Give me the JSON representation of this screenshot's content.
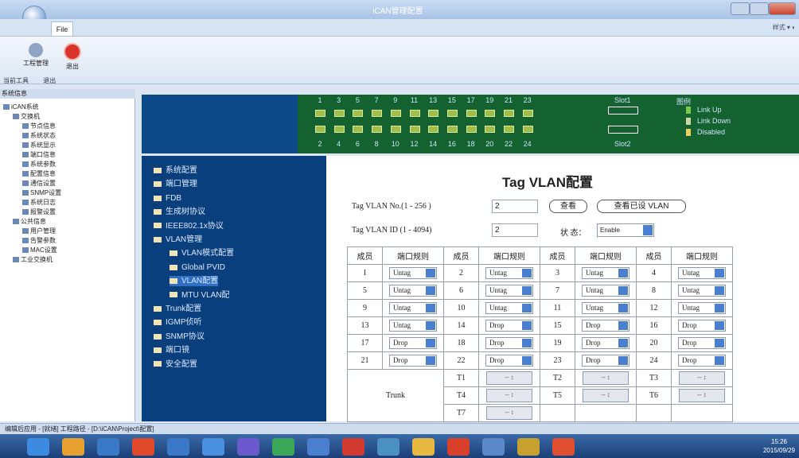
{
  "window": {
    "title": "iCAN管理配置"
  },
  "ribbon": {
    "file_tab": "File",
    "right_label": "样式 ▾ ◐",
    "buttons": [
      {
        "label": "工程管理"
      },
      {
        "label": "退出"
      }
    ],
    "groups": [
      "当前工具",
      "退出"
    ]
  },
  "tree": {
    "header": "系统信息",
    "items": [
      {
        "label": "iCAN系统",
        "level": 0
      },
      {
        "label": "交换机",
        "level": 1
      },
      {
        "label": "节点信息",
        "level": 2
      },
      {
        "label": "系统状态",
        "level": 2
      },
      {
        "label": "系统显示",
        "level": 2
      },
      {
        "label": "端口信息",
        "level": 2
      },
      {
        "label": "系统参数",
        "level": 2
      },
      {
        "label": "配置信息",
        "level": 2
      },
      {
        "label": "通信设置",
        "level": 2
      },
      {
        "label": "SNMP设置",
        "level": 2
      },
      {
        "label": "系统日志",
        "level": 2
      },
      {
        "label": "报警设置",
        "level": 2
      },
      {
        "label": "公共信息",
        "level": 1
      },
      {
        "label": "用户管理",
        "level": 2
      },
      {
        "label": "告警参数",
        "level": 2
      },
      {
        "label": "MAC设置",
        "level": 2
      },
      {
        "label": "工业交换机",
        "level": 1
      }
    ]
  },
  "ports": {
    "top_numbers": [
      "1",
      "3",
      "5",
      "7",
      "9",
      "11",
      "13",
      "15",
      "17",
      "19",
      "21",
      "23"
    ],
    "bottom_numbers": [
      "2",
      "4",
      "6",
      "8",
      "10",
      "12",
      "14",
      "16",
      "18",
      "20",
      "22",
      "24"
    ],
    "slot1": "Slot1",
    "slot2": "Slot2",
    "legend_title": "图例",
    "legend": [
      {
        "label": "Link Up",
        "color": "#7ec850"
      },
      {
        "label": "Link Down",
        "color": "#c8d8a0"
      },
      {
        "label": "Disabled",
        "color": "#e8d060"
      }
    ]
  },
  "menu": {
    "items": [
      {
        "label": "系统配置",
        "indent": 0,
        "selected": false
      },
      {
        "label": "端口管理",
        "indent": 0,
        "selected": false
      },
      {
        "label": "FDB",
        "indent": 0,
        "selected": false
      },
      {
        "label": "生成树协议",
        "indent": 0,
        "selected": false
      },
      {
        "label": "IEEE802.1x协议",
        "indent": 0,
        "selected": false
      },
      {
        "label": "VLAN管理",
        "indent": 0,
        "selected": false
      },
      {
        "label": "VLAN模式配置",
        "indent": 1,
        "selected": false
      },
      {
        "label": "Global PVID",
        "indent": 1,
        "selected": false
      },
      {
        "label": "VLAN配置",
        "indent": 1,
        "selected": true
      },
      {
        "label": "MTU VLAN配",
        "indent": 1,
        "selected": false
      },
      {
        "label": "Trunk配置",
        "indent": 0,
        "selected": false
      },
      {
        "label": "IGMP侦听",
        "indent": 0,
        "selected": false
      },
      {
        "label": "SNMP协议",
        "indent": 0,
        "selected": false
      },
      {
        "label": "端口镜",
        "indent": 0,
        "selected": false
      },
      {
        "label": "安全配置",
        "indent": 0,
        "selected": false
      }
    ]
  },
  "form": {
    "title": "Tag VLAN配置",
    "vlan_no_label": "Tag VLAN No.(1 - 256 )",
    "vlan_no_value": "2",
    "view_button": "查看",
    "view_all_button": "查看已设 VLAN",
    "vlan_id_label": "Tag VLAN ID (1 - 4094)",
    "vlan_id_value": "2",
    "status_label": "状 态：",
    "status_value": "Enable"
  },
  "table": {
    "headers": [
      "成员",
      "端口规则",
      "成员",
      "端口规则",
      "成员",
      "端口规则",
      "成员",
      "端口规则"
    ],
    "rows": [
      [
        [
          "1",
          "Untag"
        ],
        [
          "2",
          "Untag"
        ],
        [
          "3",
          "Untag"
        ],
        [
          "4",
          "Untag"
        ]
      ],
      [
        [
          "5",
          "Untag"
        ],
        [
          "6",
          "Untag"
        ],
        [
          "7",
          "Untag"
        ],
        [
          "8",
          "Untag"
        ]
      ],
      [
        [
          "9",
          "Untag"
        ],
        [
          "10",
          "Untag"
        ],
        [
          "11",
          "Untag"
        ],
        [
          "12",
          "Untag"
        ]
      ],
      [
        [
          "13",
          "Untag"
        ],
        [
          "14",
          "Drop"
        ],
        [
          "15",
          "Drop"
        ],
        [
          "16",
          "Drop"
        ]
      ],
      [
        [
          "17",
          "Drop"
        ],
        [
          "18",
          "Drop"
        ],
        [
          "19",
          "Drop"
        ],
        [
          "20",
          "Drop"
        ]
      ],
      [
        [
          "21",
          "Drop"
        ],
        [
          "22",
          "Drop"
        ],
        [
          "23",
          "Drop"
        ],
        [
          "24",
          "Drop"
        ]
      ]
    ],
    "trunk_label": "Trunk",
    "trunk_rows": [
      [
        [
          "T1",
          "-- ↕"
        ],
        [
          "T2",
          "-- ↕"
        ],
        [
          "T3",
          "-- ↕"
        ]
      ],
      [
        [
          "T4",
          "-- ↕"
        ],
        [
          "T5",
          "-- ↕"
        ],
        [
          "T6",
          "-- ↕"
        ]
      ],
      [
        [
          "T7",
          "-- ↕"
        ]
      ]
    ]
  },
  "statusbar": {
    "text": "编辑后应用 - [就绪]  工程路径 - [D:\\iCAN\\Project\\配置]"
  },
  "taskbar": {
    "apps": [
      "start-orb",
      "app-icon",
      "ie-icon",
      "chrome-icon",
      "ie-edge-icon",
      "media-icon",
      "mail-icon",
      "app-icon",
      "app-icon",
      "adobe-icon",
      "app-icon",
      "folder-icon",
      "pdf-icon",
      "settings-icon",
      "tool-icon",
      "app-icon"
    ],
    "clock_time": "15:26",
    "clock_date": "2015/09/29"
  }
}
